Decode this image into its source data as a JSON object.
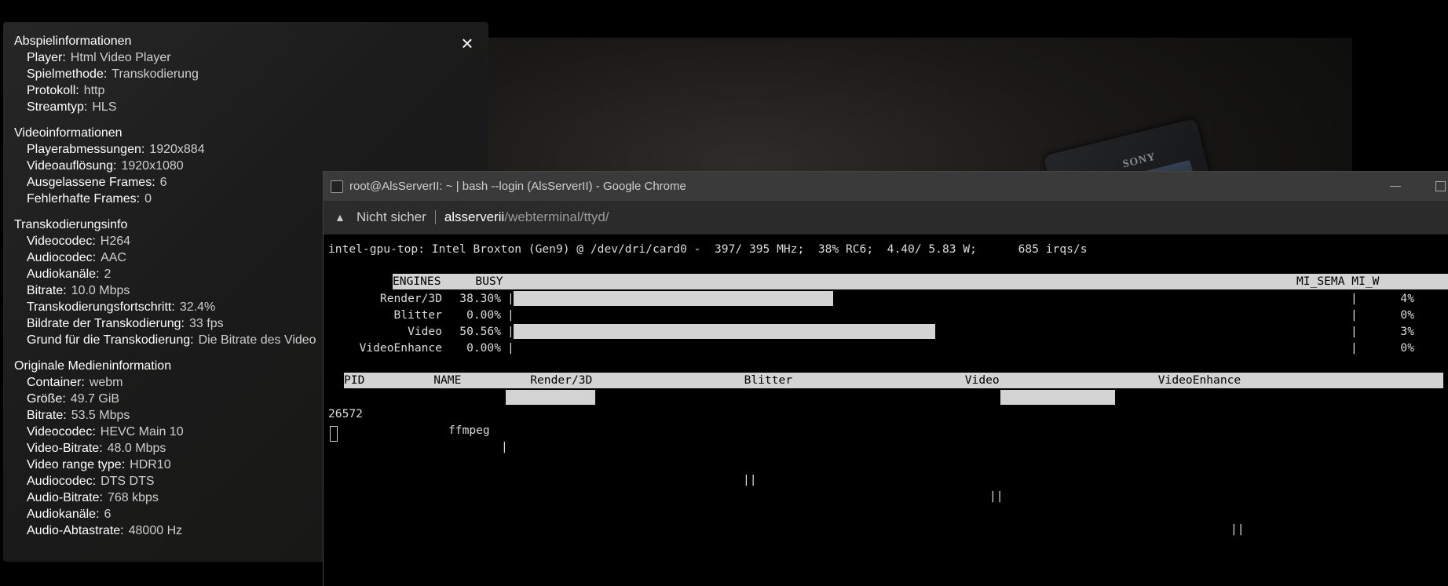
{
  "info_panel": {
    "close_icon": "×",
    "sections": [
      {
        "title": "Abspielinformationen",
        "rows": [
          {
            "label": "Player:",
            "value": "Html Video Player"
          },
          {
            "label": "Spielmethode:",
            "value": "Transkodierung"
          },
          {
            "label": "Protokoll:",
            "value": "http"
          },
          {
            "label": "Streamtyp:",
            "value": "HLS"
          }
        ]
      },
      {
        "title": "Videoinformationen",
        "rows": [
          {
            "label": "Playerabmessungen:",
            "value": "1920x884"
          },
          {
            "label": "Videoauflösung:",
            "value": "1920x1080"
          },
          {
            "label": "Ausgelassene Frames:",
            "value": "6"
          },
          {
            "label": "Fehlerhafte Frames:",
            "value": "0"
          }
        ]
      },
      {
        "title": "Transkodierungsinfo",
        "rows": [
          {
            "label": "Videocodec:",
            "value": "H264"
          },
          {
            "label": "Audiocodec:",
            "value": "AAC"
          },
          {
            "label": "Audiokanäle:",
            "value": "2"
          },
          {
            "label": "Bitrate:",
            "value": "10.0 Mbps"
          },
          {
            "label": "Transkodierungsfortschritt:",
            "value": "32.4%"
          },
          {
            "label": "Bildrate der Transkodierung:",
            "value": "33 fps"
          },
          {
            "label": "Grund für die Transkodierung:",
            "value": "Die Bitrate des Video"
          }
        ]
      },
      {
        "title": "Originale Medieninformation",
        "rows": [
          {
            "label": "Container:",
            "value": "webm"
          },
          {
            "label": "Größe:",
            "value": "49.7 GiB"
          },
          {
            "label": "Bitrate:",
            "value": "53.5 Mbps"
          },
          {
            "label": "Videocodec:",
            "value": "HEVC Main 10"
          },
          {
            "label": "Video-Bitrate:",
            "value": "48.0 Mbps"
          },
          {
            "label": "Video range type:",
            "value": "HDR10"
          },
          {
            "label": "Audiocodec:",
            "value": "DTS DTS"
          },
          {
            "label": "Audio-Bitrate:",
            "value": "768 kbps"
          },
          {
            "label": "Audiokanäle:",
            "value": "6"
          },
          {
            "label": "Audio-Abtastrate:",
            "value": "48000 Hz"
          }
        ]
      }
    ]
  },
  "video": {
    "brand_text": "SONY"
  },
  "chrome_window": {
    "title": "root@AlsServerII: ~ | bash --login (AlsServerII) - Google Chrome",
    "url_warning": "Nicht sicher",
    "url_host": "alsserverii",
    "url_path": "/webterminal/ttyd/"
  },
  "terminal": {
    "top_line": "intel-gpu-top: Intel Broxton (Gen9) @ /dev/dri/card0 -  397/ 395 MHz;  38% RC6;  4.40/ 5.83 W;      685 irqs/s",
    "engines_header": "ENGINES     BUSY                                                                                                                   MI_SEMA MI_W",
    "engines": [
      {
        "name": "Render/3D",
        "busy": "38.30%",
        "busy_fraction": 0.383,
        "sema": "4%"
      },
      {
        "name": "Blitter",
        "busy": "0.00%",
        "busy_fraction": 0.0,
        "sema": "0%"
      },
      {
        "name": "Video",
        "busy": "50.56%",
        "busy_fraction": 0.5056,
        "sema": "3%"
      },
      {
        "name": "VideoEnhance",
        "busy": "0.00%",
        "busy_fraction": 0.0,
        "sema": "0%"
      }
    ],
    "proc_header": "PID          NAME          Render/3D                      Blitter                         Video                       VideoEnhance",
    "process": {
      "pid": "26572",
      "name": "ffmpeg"
    }
  }
}
